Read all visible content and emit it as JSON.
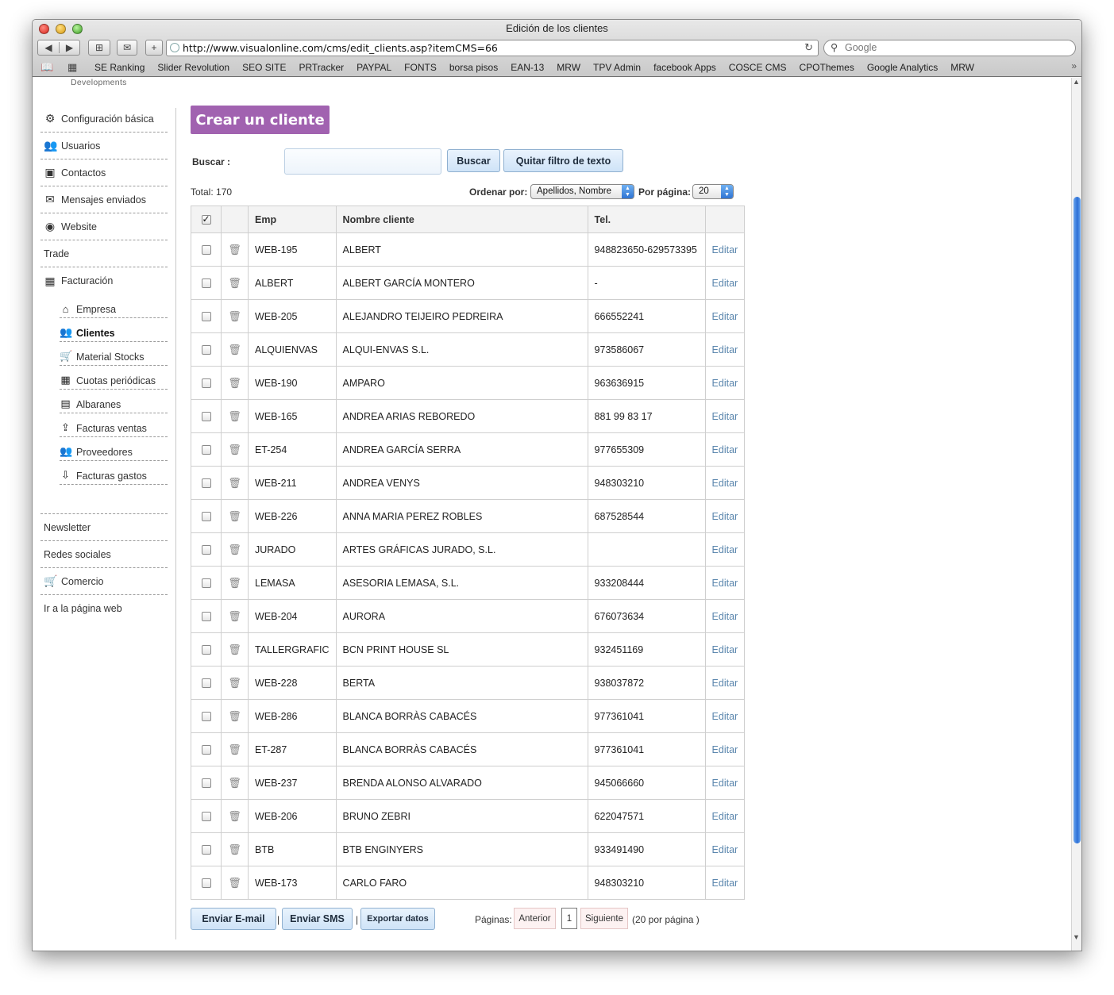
{
  "window": {
    "title": "Edición de los clientes"
  },
  "toolbar": {
    "url": "http://www.visualonline.com/cms/edit_clients.asp?itemCMS=66",
    "search_placeholder": "Google",
    "back": "◀",
    "forward": "▶",
    "add_bookmark": "+",
    "reload": "↻"
  },
  "bookmarks": [
    "SE Ranking",
    "Slider Revolution",
    "SEO SITE",
    "PRTracker",
    "PAYPAL",
    "FONTS",
    "borsa pisos",
    "EAN-13",
    "MRW",
    "TPV Admin",
    "facebook Apps",
    "COSCE CMS",
    "CPOThemes",
    "Google Analytics",
    "MRW"
  ],
  "site": {
    "logo_text": "Developments"
  },
  "sidebar": {
    "items": [
      {
        "label": "Configuración básica",
        "icon": "gear-icon"
      },
      {
        "label": "Usuarios",
        "icon": "users-icon"
      },
      {
        "label": "Contactos",
        "icon": "address-book-icon"
      },
      {
        "label": "Mensajes enviados",
        "icon": "envelope-icon"
      },
      {
        "label": "Website",
        "icon": "globe-icon"
      },
      {
        "label": "Trade",
        "icon": ""
      },
      {
        "label": "Facturación",
        "icon": "calculator-icon"
      }
    ],
    "sub_items": [
      {
        "label": "Empresa",
        "icon": "home-icon"
      },
      {
        "label": "Clientes",
        "icon": "clients-icon"
      },
      {
        "label": "Material Stocks",
        "icon": "cart-icon"
      },
      {
        "label": "Cuotas periódicas",
        "icon": "calendar-icon"
      },
      {
        "label": "Albaranes",
        "icon": "clipboard-icon"
      },
      {
        "label": "Facturas ventas",
        "icon": "invoice-out-icon"
      },
      {
        "label": "Proveedores",
        "icon": "suppliers-icon"
      },
      {
        "label": "Facturas gastos",
        "icon": "invoice-in-icon"
      }
    ],
    "bottom_items": [
      {
        "label": "Newsletter"
      },
      {
        "label": "Redes sociales"
      },
      {
        "label": "Comercio"
      },
      {
        "label": "Ir a la página web"
      }
    ]
  },
  "main": {
    "create_button": "Crear un cliente",
    "search_label": "Buscar :",
    "search_value": "",
    "search_button": "Buscar",
    "clear_filter_button": "Quitar filtro de texto",
    "total": "Total: 170",
    "order_label": "Ordenar por:",
    "order_value": "Apellidos, Nombre",
    "per_page_label": "Por página:",
    "per_page_value": "20"
  },
  "table": {
    "headers": [
      "Emp",
      "Nombre cliente",
      "Tel."
    ],
    "edit_label": "Editar",
    "rows": [
      {
        "emp": "WEB-195",
        "name": "ALBERT",
        "tel": "948823650-629573395"
      },
      {
        "emp": "ALBERT",
        "name": "ALBERT GARCÍA MONTERO",
        "tel": "-"
      },
      {
        "emp": "WEB-205",
        "name": "ALEJANDRO TEIJEIRO PEDREIRA",
        "tel": "666552241"
      },
      {
        "emp": "ALQUIENVAS",
        "name": "ALQUI-ENVAS S.L.",
        "tel": "973586067"
      },
      {
        "emp": "WEB-190",
        "name": "AMPARO",
        "tel": "963636915"
      },
      {
        "emp": "WEB-165",
        "name": "ANDREA ARIAS REBOREDO",
        "tel": "881 99 83 17"
      },
      {
        "emp": "ET-254",
        "name": "ANDREA GARCÍA SERRA",
        "tel": "977655309"
      },
      {
        "emp": "WEB-211",
        "name": "ANDREA VENYS",
        "tel": "948303210"
      },
      {
        "emp": "WEB-226",
        "name": "ANNA MARIA PEREZ ROBLES",
        "tel": "687528544"
      },
      {
        "emp": "JURADO",
        "name": "ARTES GRÁFICAS JURADO, S.L.",
        "tel": ""
      },
      {
        "emp": "LEMASA",
        "name": "ASESORIA LEMASA, S.L.",
        "tel": "933208444"
      },
      {
        "emp": "WEB-204",
        "name": "AURORA",
        "tel": "676073634"
      },
      {
        "emp": "TALLERGRAFIC",
        "name": "BCN PRINT HOUSE SL",
        "tel": "932451169"
      },
      {
        "emp": "WEB-228",
        "name": "BERTA",
        "tel": "938037872"
      },
      {
        "emp": "WEB-286",
        "name": "BLANCA BORRÀS CABACÉS",
        "tel": "977361041"
      },
      {
        "emp": "ET-287",
        "name": "BLANCA BORRÀS CABACÉS",
        "tel": "977361041"
      },
      {
        "emp": "WEB-237",
        "name": "BRENDA ALONSO ALVARADO",
        "tel": "945066660"
      },
      {
        "emp": "WEB-206",
        "name": "BRUNO ZEBRI",
        "tel": "622047571"
      },
      {
        "emp": "BTB",
        "name": "BTB ENGINYERS",
        "tel": "933491490"
      },
      {
        "emp": "WEB-173",
        "name": "CARLO FARO",
        "tel": "948303210"
      }
    ]
  },
  "footer": {
    "send_email": "Enviar E-mail",
    "send_sms": "Enviar SMS",
    "export": "Exportar datos",
    "separator": "|",
    "pages_label": "Páginas:",
    "prev": "Anterior",
    "current_page": "1",
    "next": "Siguiente",
    "per_page_note": "(20 por página )"
  }
}
